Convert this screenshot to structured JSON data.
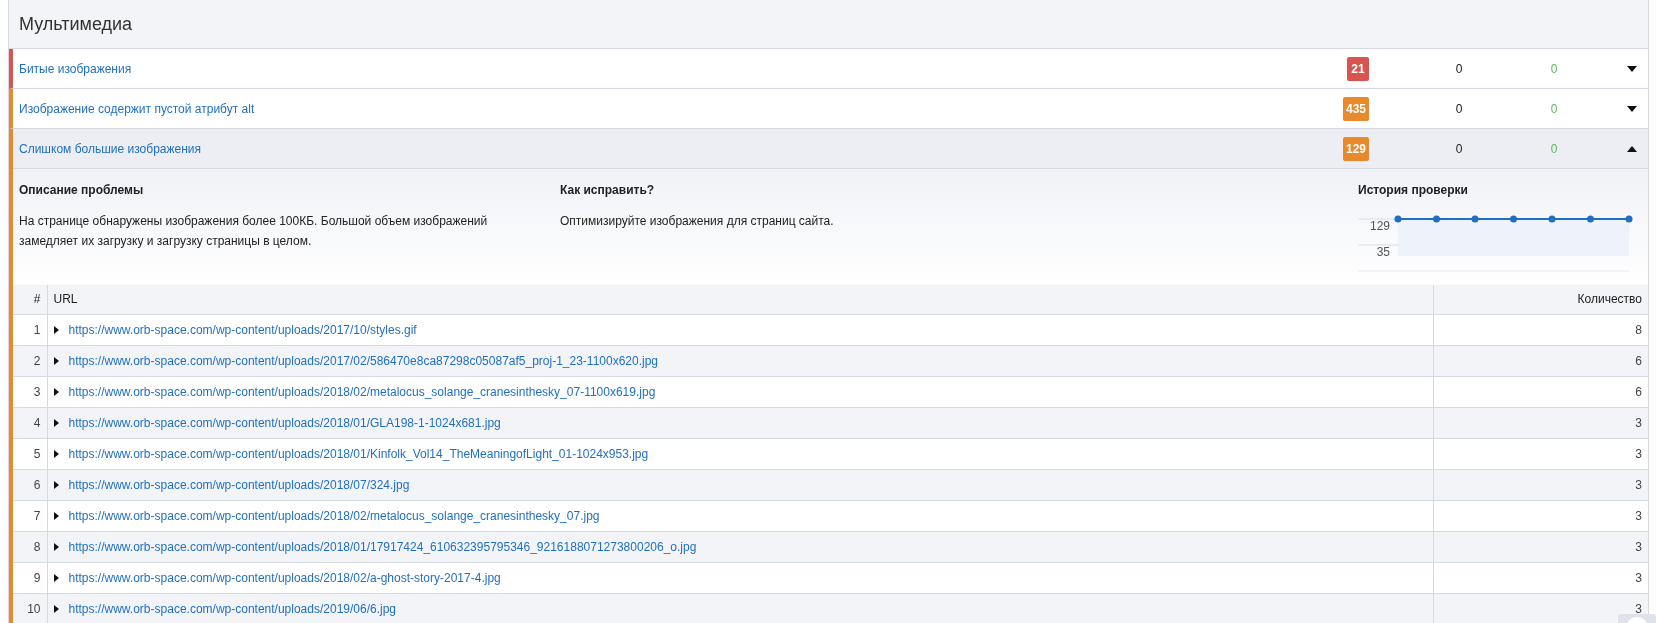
{
  "section_title": "Мультимедиа",
  "issues": [
    {
      "title": "Битые изображения",
      "count": "21",
      "color": "#d9534f",
      "col_2": "0",
      "col_3": "0",
      "expanded": false
    },
    {
      "title": "Изображение содержит пустой атрибут alt",
      "count": "435",
      "color": "#e8892b",
      "col_2": "0",
      "col_3": "0",
      "expanded": false
    },
    {
      "title": "Слишком большие изображения",
      "count": "129",
      "color": "#e8892b",
      "col_2": "0",
      "col_3": "0",
      "expanded": true,
      "details": {
        "description_title": "Описание проблемы",
        "description": "На странице обнаружены изображения более 100КБ. Большой объем изображений замедляет их загрузку и загрузку страницы в целом.",
        "fix_title": "Как исправить?",
        "fix": "Оптимизируйте изображения для страниц сайта.",
        "history_title": "История проверки",
        "chart_data": {
          "type": "line",
          "ylim": [
            35,
            129
          ],
          "yticks": [
            35,
            129
          ],
          "series": [
            {
              "color": "#1f6fc5",
              "marker": "circle",
              "values": [
                129,
                129,
                129,
                129,
                129,
                129,
                129
              ]
            }
          ]
        }
      },
      "table": {
        "columns": [
          "#",
          "URL",
          "Количество"
        ],
        "rows": [
          {
            "n": "1",
            "url": "https://www.orb-space.com/wp-content/uploads/2017/10/styles.gif",
            "count": "8"
          },
          {
            "n": "2",
            "url": "https://www.orb-space.com/wp-content/uploads/2017/02/586470e8ca87298c05087af5_proj-1_23-1100x620.jpg",
            "count": "6"
          },
          {
            "n": "3",
            "url": "https://www.orb-space.com/wp-content/uploads/2018/02/metalocus_solange_cranesinthesky_07-1100x619.jpg",
            "count": "6"
          },
          {
            "n": "4",
            "url": "https://www.orb-space.com/wp-content/uploads/2018/01/GLA198-1-1024x681.jpg",
            "count": "3"
          },
          {
            "n": "5",
            "url": "https://www.orb-space.com/wp-content/uploads/2018/01/Kinfolk_Vol14_TheMeaningofLight_01-1024x953.jpg",
            "count": "3"
          },
          {
            "n": "6",
            "url": "https://www.orb-space.com/wp-content/uploads/2018/07/324.jpg",
            "count": "3"
          },
          {
            "n": "7",
            "url": "https://www.orb-space.com/wp-content/uploads/2018/02/metalocus_solange_cranesinthesky_07.jpg",
            "count": "3"
          },
          {
            "n": "8",
            "url": "https://www.orb-space.com/wp-content/uploads/2018/01/17917424_610632395795346_9216188071273800206_o.jpg",
            "count": "3"
          },
          {
            "n": "9",
            "url": "https://www.orb-space.com/wp-content/uploads/2018/02/a-ghost-story-2017-4.jpg",
            "count": "3"
          },
          {
            "n": "10",
            "url": "https://www.orb-space.com/wp-content/uploads/2019/06/6.jpg",
            "count": "3"
          }
        ]
      }
    }
  ]
}
